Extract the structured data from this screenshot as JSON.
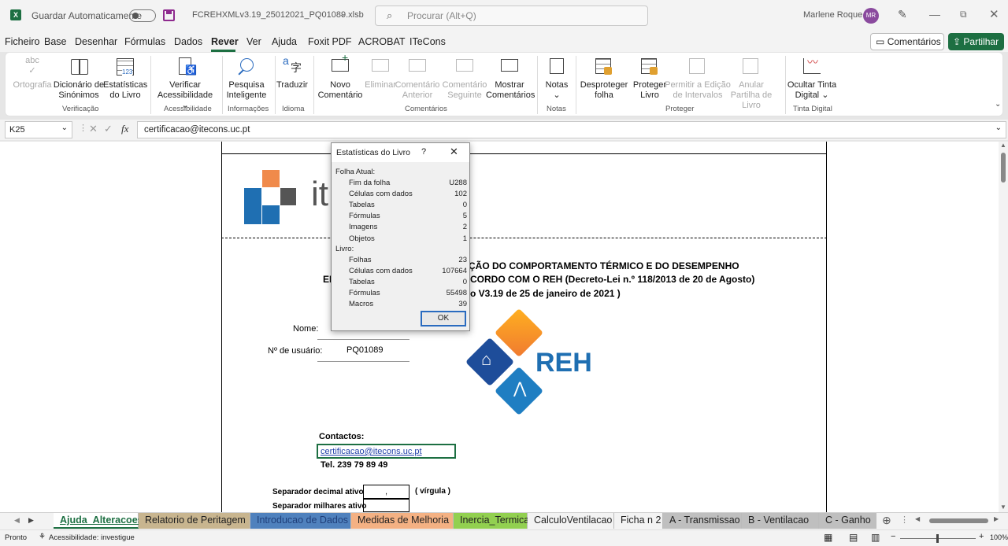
{
  "titlebar": {
    "autosave_label": "Guardar Automaticamente",
    "filename": "FCREHXMLv3.19_25012021_PQ01089.xlsb",
    "search_placeholder": "Procurar (Alt+Q)",
    "user_name": "Marlene Roque",
    "user_initials": "MR"
  },
  "menu": [
    "Ficheiro",
    "Base",
    "Desenhar",
    "Fórmulas",
    "Dados",
    "Rever",
    "Ver",
    "Ajuda",
    "Foxit PDF",
    "ACROBAT",
    "ITeCons"
  ],
  "active_tab": "Rever",
  "comments_btn": "Comentários",
  "share_btn": "Partilhar",
  "ribbon": {
    "ortografia": "Ortografia",
    "dicionario": "Dicionário de Sinónimos",
    "estatisticas": "Estatísticas do Livro",
    "verificacao": "Verificação",
    "verificar": "Verificar Acessibilidade",
    "acessibilidade": "Acessibilidade",
    "pesquisa": "Pesquisa Inteligente",
    "informacoes": "Informações",
    "traduzir": "Traduzir",
    "idioma": "Idioma",
    "novo": "Novo Comentário",
    "eliminar": "Eliminar",
    "anterior": "Comentário Anterior",
    "seguinte": "Comentário Seguinte",
    "mostrar": "Mostrar Comentários",
    "comentarios": "Comentários",
    "notas": "Notas",
    "notas_grp": "Notas",
    "desproteger": "Desproteger folha",
    "proteger": "Proteger Livro",
    "permitir": "Permitir a Edição de Intervalos",
    "anular": "Anular Partilha de Livro",
    "proteger_grp": "Proteger",
    "ocultar": "Ocultar Tinta Digital",
    "tinta_grp": "Tinta Digital"
  },
  "namebox": "K25",
  "formula": "certificacao@itecons.uc.pt",
  "fx": "fx",
  "dialog": {
    "title": "Estatísticas do Livro",
    "help": "?",
    "current_sheet": "Folha Atual:",
    "sheet_rows": [
      [
        "Fim da folha",
        "U288"
      ],
      [
        "Células com dados",
        "102"
      ],
      [
        "Tabelas",
        "0"
      ],
      [
        "Fórmulas",
        "5"
      ],
      [
        "Imagens",
        "2"
      ],
      [
        "Objetos",
        "1"
      ]
    ],
    "workbook": "Livro:",
    "book_rows": [
      [
        "Folhas",
        "23"
      ],
      [
        "Células com dados",
        "107664"
      ],
      [
        "Tabelas",
        "0"
      ],
      [
        "Fórmulas",
        "55498"
      ],
      [
        "Macros",
        "39"
      ]
    ],
    "ok": "OK"
  },
  "doc": {
    "logo_text": "it",
    "line1": "ÇÃO DO COMPORTAMENTO TÉRMICO E DO DESEMPENHO",
    "line2_prefix": "EI",
    "line2": "CORDO COM O REH (Decreto-Lei n.º 118/2013 de 20 de Agosto)",
    "line3": "o V3.19 de 25 de janeiro de 2021 )",
    "nome_label": "Nome:",
    "user_label": "Nº de usuário:",
    "user_value": "PQ01089",
    "reh": "REH",
    "contactos": "Contactos:",
    "email": "certificacao@itecons.uc.pt",
    "tel": "Tel.  239 79 89 49",
    "sep_decimal": "Separador decimal ativo",
    "sep_decimal_val": ",",
    "virgula": "( vírgula )",
    "sep_milhares": "Separador milhares ativo"
  },
  "sheets": [
    "Ajuda_Alteracoes",
    "Relatorio de Peritagem",
    "Introducao de Dados",
    "Medidas de Melhoria",
    "Inercia_Termica",
    "CalculoVentilacao",
    "Ficha n 2",
    "A - Transmissao",
    "B - Ventilacao",
    "C - Ganho"
  ],
  "sheet_colors": [
    "#ffffff",
    "#c8b58f",
    "#4f81bd",
    "#f4b183",
    "#92d050",
    "#f3f3f3",
    "#f3f3f3",
    "#bfbfbf",
    "#bfbfbf",
    "#bfbfbf"
  ],
  "status": {
    "ready": "Pronto",
    "access": "Acessibilidade: investigue",
    "zoom": "100%"
  }
}
